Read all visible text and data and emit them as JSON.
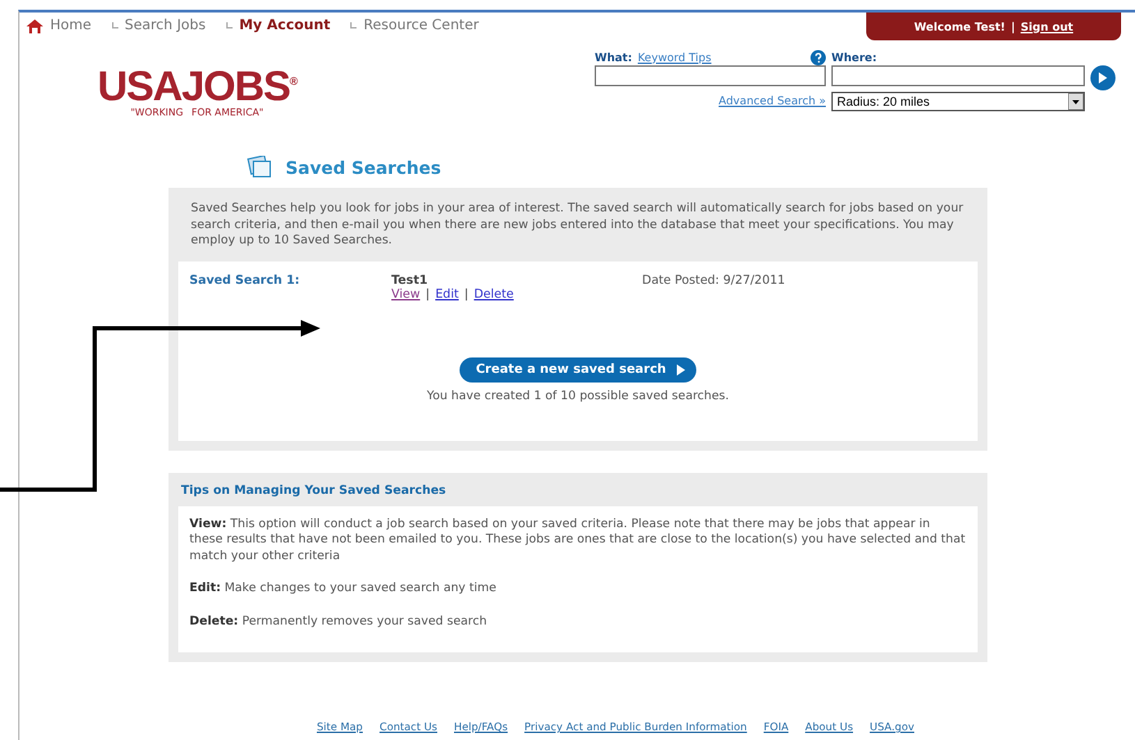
{
  "nav": {
    "items": [
      {
        "label": "Home",
        "selected": false,
        "kind": "home"
      },
      {
        "label": "Search Jobs",
        "selected": false,
        "kind": "link"
      },
      {
        "label": "My Account",
        "selected": true,
        "kind": "link"
      },
      {
        "label": "Resource Center",
        "selected": false,
        "kind": "link"
      }
    ],
    "welcome": "Welcome Test!",
    "separator": "|",
    "sign_out": "Sign out"
  },
  "logo": {
    "name": "USAJOBS",
    "reg": "®",
    "tagline_left": "\"WORKING",
    "tagline_right": "FOR AMERICA\""
  },
  "search": {
    "what_label": "What:",
    "keyword_tips": "Keyword Tips",
    "where_label": "Where:",
    "advanced": "Advanced Search »",
    "radius": "Radius: 20 miles"
  },
  "saved": {
    "title": "Saved Searches",
    "intro": "Saved Searches help you look for jobs in your area of interest. The saved search will automatically search for jobs based on your search criteria, and then e-mail you when there are new jobs entered into the database that meet your specifications. You may employ up to 10 Saved Searches.",
    "entries": [
      {
        "label": "Saved Search 1:",
        "name": "Test1",
        "actions": [
          {
            "label": "View",
            "visited": true
          },
          {
            "label": "Edit",
            "visited": false
          },
          {
            "label": "Delete",
            "visited": false
          }
        ],
        "date": "Date Posted: 9/27/2011"
      }
    ],
    "create_button": "Create a new saved search",
    "count_note": "You have created 1 of 10 possible saved searches."
  },
  "tips": {
    "title": "Tips on Managing Your Saved Searches",
    "items": [
      {
        "term": "View:",
        "text": "This option will conduct a job search based on your saved criteria. Please note that there may be jobs that appear in these results that have not been emailed to you. These jobs are ones that are close to the location(s) you have selected and that match your other criteria"
      },
      {
        "term": "Edit:",
        "text": "Make changes to your saved search any time"
      },
      {
        "term": "Delete:",
        "text": "Permanently removes your saved search"
      }
    ]
  },
  "footer": [
    "Site Map",
    "Contact Us",
    "Help/FAQs",
    "Privacy Act and Public Burden Information",
    "FOIA",
    "About Us",
    "USA.gov"
  ]
}
